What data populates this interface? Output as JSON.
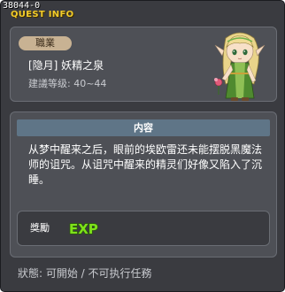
{
  "window": {
    "id_label": "38044-0",
    "title": "QUEST INFO"
  },
  "quest": {
    "job_badge": "職業",
    "name": "[隐月] 妖精之泉",
    "level": "建議等级: 40~44"
  },
  "content": {
    "header": "内容",
    "description": "从梦中醒来之后，眼前的埃欧雷还未能摆脱黑魔法师的诅咒。从诅咒中醒来的精灵们好像又陷入了沉睡。"
  },
  "reward": {
    "label": "獎勵",
    "icon_text": "EXP"
  },
  "status": {
    "text": "狀態: 可開始 / 不可执行任務"
  },
  "colors": {
    "window_bg": "#3a3b40",
    "panel_bg": "#4e5056",
    "title": "#f2cc2a",
    "header_bg": "#5f7587",
    "badge_bg": "#c8b293",
    "exp_green": "#7ee21a"
  },
  "icons": {
    "npc": "elf-npc-portrait-icon",
    "exp": "exp-icon"
  }
}
